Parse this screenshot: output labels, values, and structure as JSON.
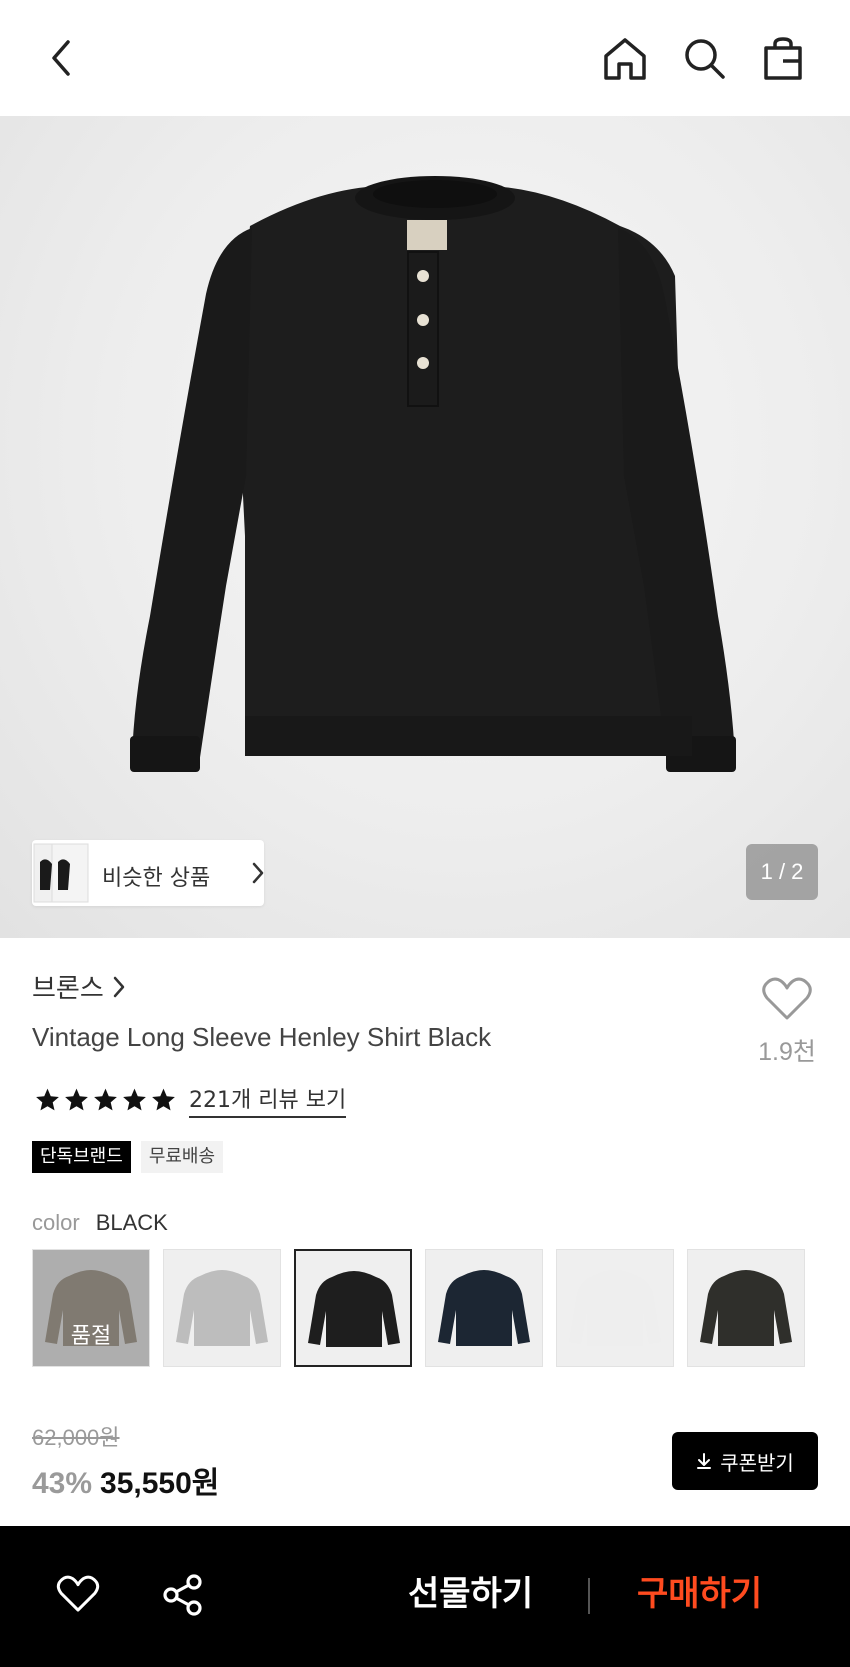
{
  "header": {
    "back_icon": "chevron-left-icon",
    "home_icon": "home-icon",
    "search_icon": "search-icon",
    "bag_icon": "shopping-bag-icon"
  },
  "gallery": {
    "similar_label": "비슷한 상품",
    "page_indicator": "1 / 2"
  },
  "product": {
    "brand": "브론스",
    "title": "Vintage Long Sleeve Henley Shirt Black",
    "likes": "1.9천",
    "rating_stars": 5,
    "review_link": "221개 리뷰 보기",
    "badges": [
      "단독브랜드",
      "무료배송"
    ],
    "color_label": "color",
    "color_value": "BLACK"
  },
  "swatches": [
    {
      "color": "#8b7c68",
      "sold_out": true,
      "sold_out_label": "품절"
    },
    {
      "color": "#bdbdbd",
      "sold_out": false
    },
    {
      "color": "#1e1e1e",
      "sold_out": false,
      "selected": true
    },
    {
      "color": "#1c2633",
      "sold_out": false
    },
    {
      "color": "#eeeeee",
      "sold_out": false
    },
    {
      "color": "#2f2f2b",
      "sold_out": false
    }
  ],
  "price": {
    "original": "62,000원",
    "discount": "43%",
    "final": "35,550원",
    "coupon_label": "쿠폰받기"
  },
  "bottom_bar": {
    "gift_label": "선물하기",
    "buy_label": "구매하기",
    "buy_color": "#ff4b1f"
  }
}
